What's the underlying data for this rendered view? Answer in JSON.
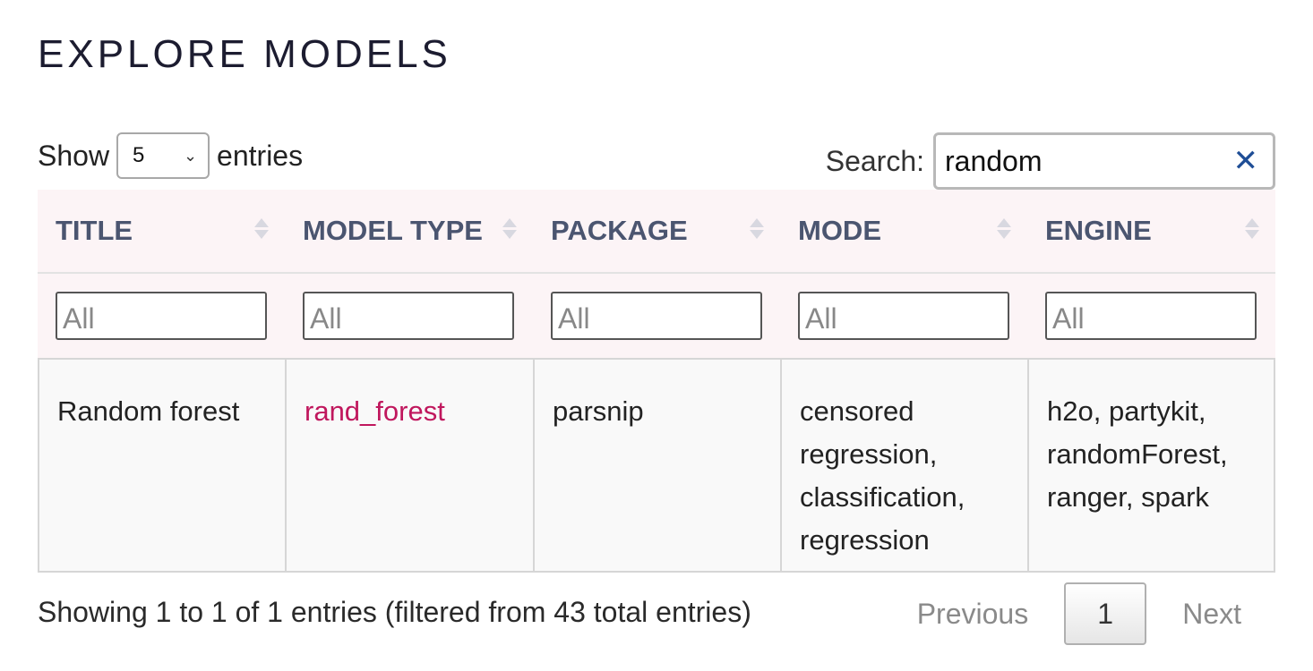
{
  "page": {
    "title": "EXPLORE MODELS"
  },
  "length": {
    "show_label": "Show",
    "value": "5",
    "entries_label": "entries"
  },
  "search": {
    "label": "Search:",
    "value": "random"
  },
  "table": {
    "columns": [
      "TITLE",
      "MODEL TYPE",
      "PACKAGE",
      "MODE",
      "ENGINE"
    ],
    "filter_placeholder": "All",
    "rows": [
      {
        "title": "Random forest",
        "model_type": "rand_forest",
        "package": "parsnip",
        "mode": "censored regression, classification, regression",
        "engine": "h2o, partykit, randomForest, ranger, spark"
      }
    ]
  },
  "info": {
    "text": "Showing 1 to 1 of 1 entries (filtered from 43 total entries)"
  },
  "pagination": {
    "previous": "Previous",
    "current": "1",
    "next": "Next"
  },
  "colors": {
    "link": "#c0175d",
    "header_bg": "#fcf4f6",
    "clear_icon": "#1f4e96"
  }
}
